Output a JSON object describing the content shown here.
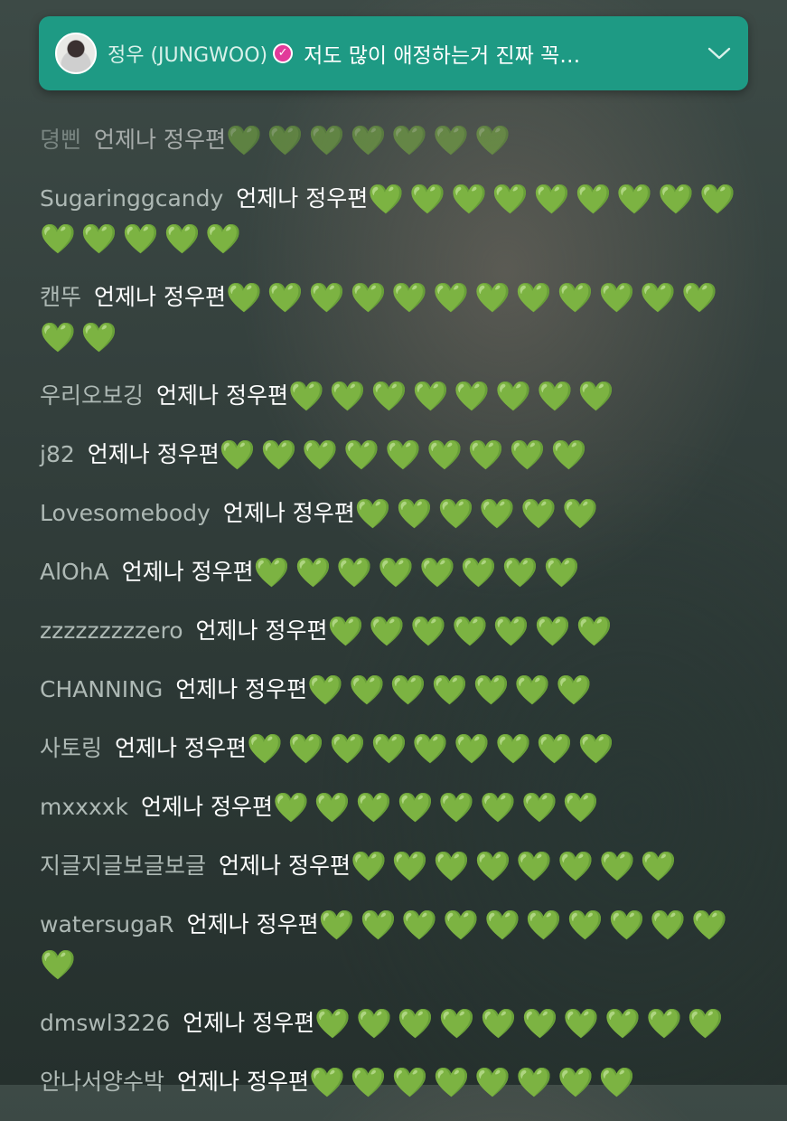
{
  "banner": {
    "name": "정우 (JUNGWOO)",
    "verified_icon": "verified-check-icon",
    "message": "저도 많이 애정하는거 진짜 꼭…",
    "chevron_icon": "chevron-down-icon",
    "colors": {
      "background": "#1e9a84",
      "verified": "#e23a9a"
    }
  },
  "heart_color": "#3fc23a",
  "messages": [
    {
      "user": "뎡삔",
      "text": "언제나 정우편",
      "hearts": "💚💚💚💚💚💚💚"
    },
    {
      "user": "Sugaringgcandy",
      "text": "언제나 정우편",
      "hearts": "💚💚💚💚💚💚💚💚💚💚💚💚💚💚"
    },
    {
      "user": "캔뚜",
      "text": "언제나 정우편",
      "hearts": "💚💚💚💚💚💚💚💚💚💚💚💚💚💚"
    },
    {
      "user": "우리오보깅",
      "text": "언제나 정우편",
      "hearts": "💚💚💚💚💚💚💚💚"
    },
    {
      "user": "j82",
      "text": "언제나 정우편",
      "hearts": "💚💚💚💚💚💚💚💚💚"
    },
    {
      "user": "Lovesomebody",
      "text": "언제나 정우편",
      "hearts": "💚💚💚💚💚💚"
    },
    {
      "user": "AlOhA",
      "text": "언제나 정우편",
      "hearts": "💚💚💚💚💚💚💚💚"
    },
    {
      "user": "zzzzzzzzzero",
      "text": "언제나 정우편",
      "hearts": "💚💚💚💚💚💚💚"
    },
    {
      "user": "CHANNING",
      "text": "언제나 정우편",
      "hearts": "💚💚💚💚💚💚💚"
    },
    {
      "user": "사토링",
      "text": "언제나 정우편",
      "hearts": "💚💚💚💚💚💚💚💚💚"
    },
    {
      "user": "mxxxxk",
      "text": "언제나 정우편",
      "hearts": "💚💚💚💚💚💚💚💚"
    },
    {
      "user": "지글지글보글보글",
      "text": "언제나 정우편",
      "hearts": "💚💚💚💚💚💚💚💚"
    },
    {
      "user": "watersugaR",
      "text": "언제나 정우편",
      "hearts": "💚💚💚💚💚💚💚💚💚💚💚"
    },
    {
      "user": "dmswl3226",
      "text": "언제나 정우편",
      "hearts": "💚💚💚💚💚💚💚💚💚💚"
    },
    {
      "user": "안나서양수박",
      "text": "언제나 정우편",
      "hearts": "💚💚💚💚💚💚💚💚"
    }
  ]
}
